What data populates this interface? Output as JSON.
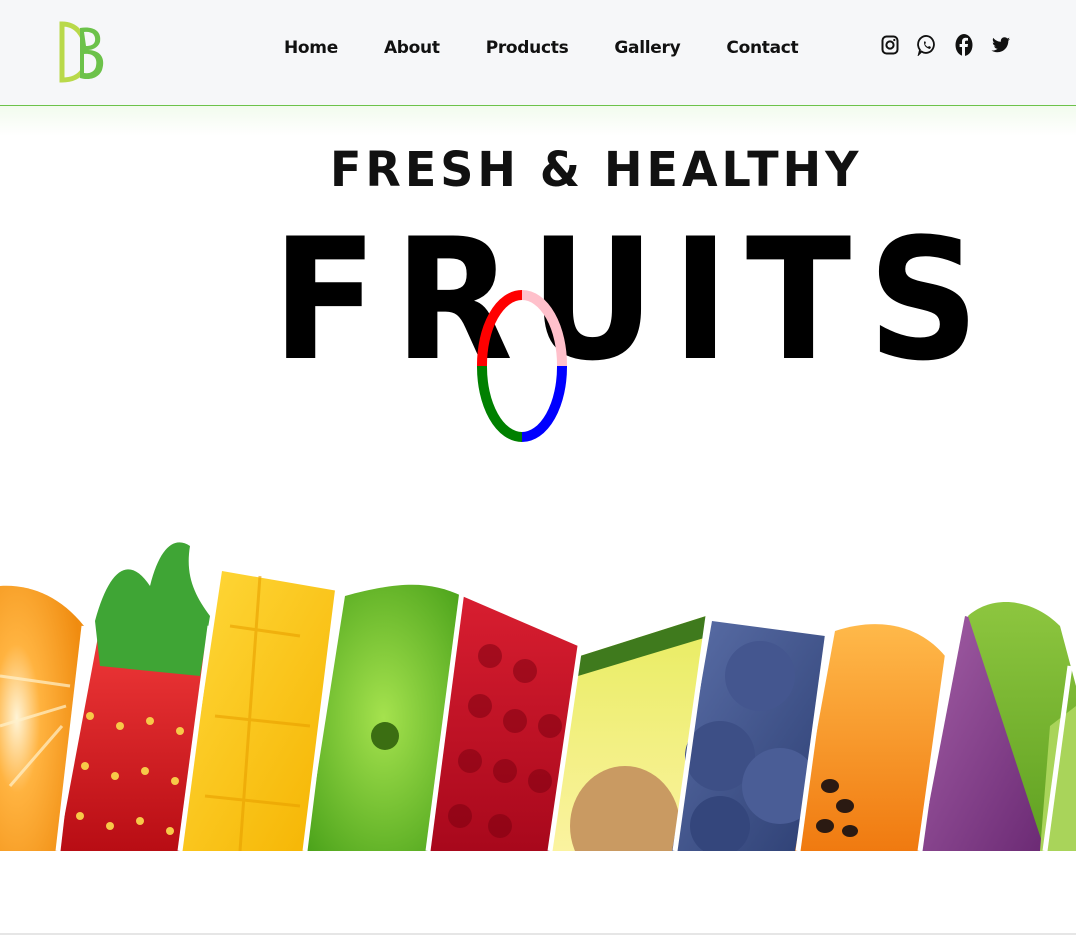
{
  "header": {
    "logo_text": "DB",
    "nav": [
      {
        "label": "Home"
      },
      {
        "label": "About"
      },
      {
        "label": "Products"
      },
      {
        "label": "Gallery"
      },
      {
        "label": "Contact"
      }
    ],
    "social": [
      "instagram-icon",
      "whatsapp-icon",
      "facebook-icon",
      "twitter-icon"
    ]
  },
  "hero": {
    "subtitle": "FRESH & HEALTHY",
    "title": "FRUITS",
    "fruits": [
      "orange",
      "strawberry",
      "mango",
      "green-apple",
      "pomegranate",
      "avocado",
      "blueberry",
      "papaya",
      "passion-fruit",
      "kiwi"
    ]
  },
  "colors": {
    "accent": "#6cc24a",
    "loader": [
      "#ff0000",
      "#ffc0cb",
      "#0000ff",
      "#008000"
    ]
  }
}
